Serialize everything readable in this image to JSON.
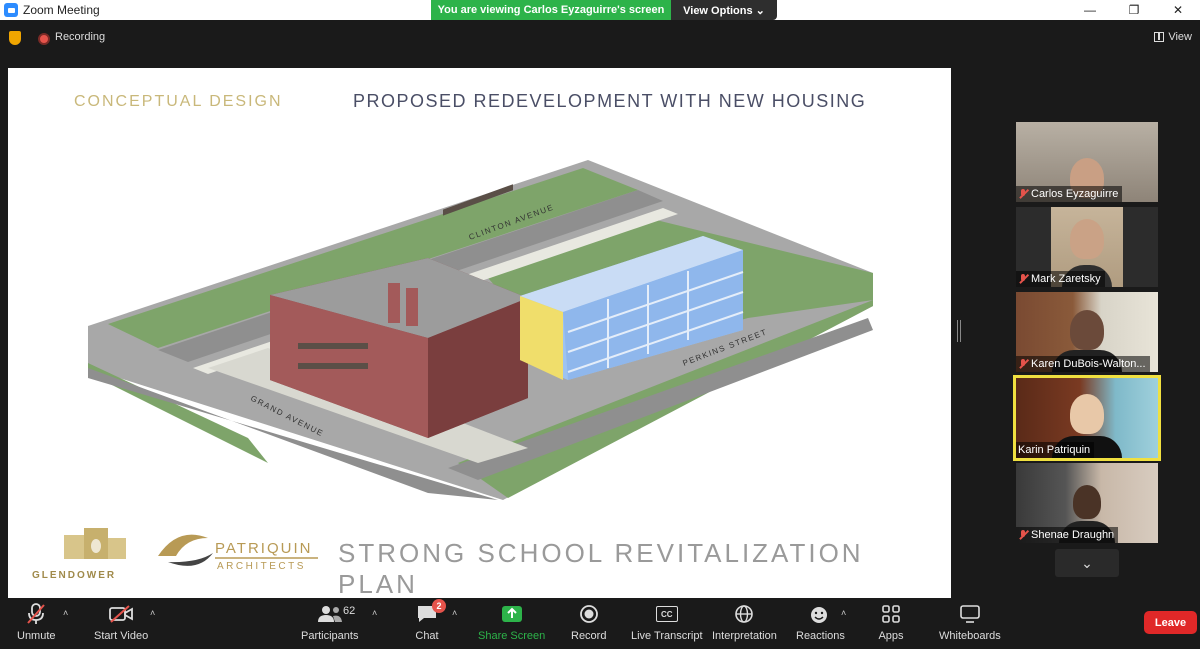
{
  "window": {
    "title": "Zoom Meeting",
    "minimize_icon": "minimize-icon",
    "maximize_icon": "restore-icon",
    "close_icon": "close-icon"
  },
  "banner": {
    "viewing_text": "You are viewing Carlos Eyzaguirre's screen",
    "view_options_label": "View Options ⌄"
  },
  "status": {
    "recording_label": "Recording",
    "view_label": "View"
  },
  "slide": {
    "conceptual_label": "CONCEPTUAL DESIGN",
    "heading": "PROPOSED REDEVELOPMENT WITH NEW HOUSING",
    "street_clinton": "CLINTON AVENUE",
    "street_perkins": "PERKINS STREET",
    "street_grand": "GRAND AVENUE",
    "logo_glendower": "GLENDOWER",
    "logo_patriquin": "PATRIQUIN",
    "logo_architects": "ARCHITECTS",
    "plan_title": "STRONG SCHOOL REVITALIZATION PLAN"
  },
  "participants": [
    {
      "name": "Carlos Eyzaguirre",
      "muted": true
    },
    {
      "name": "Mark Zaretsky",
      "muted": true
    },
    {
      "name": "Karen DuBois-Walton...",
      "muted": true
    },
    {
      "name": "Karin Patriquin",
      "muted": false,
      "active": true
    },
    {
      "name": "Shenae Draughn",
      "muted": true
    }
  ],
  "toolbar": {
    "unmute_label": "Unmute",
    "start_video_label": "Start Video",
    "participants_label": "Participants",
    "participants_count": "62",
    "chat_label": "Chat",
    "chat_badge": "2",
    "share_screen_label": "Share Screen",
    "record_label": "Record",
    "live_transcript_label": "Live Transcript",
    "cc_text": "CC",
    "interpretation_label": "Interpretation",
    "reactions_label": "Reactions",
    "apps_label": "Apps",
    "whiteboards_label": "Whiteboards",
    "leave_label": "Leave"
  },
  "colors": {
    "accent_green": "#2db34a",
    "leave_red": "#e02828",
    "active_speaker": "#f0e040"
  }
}
